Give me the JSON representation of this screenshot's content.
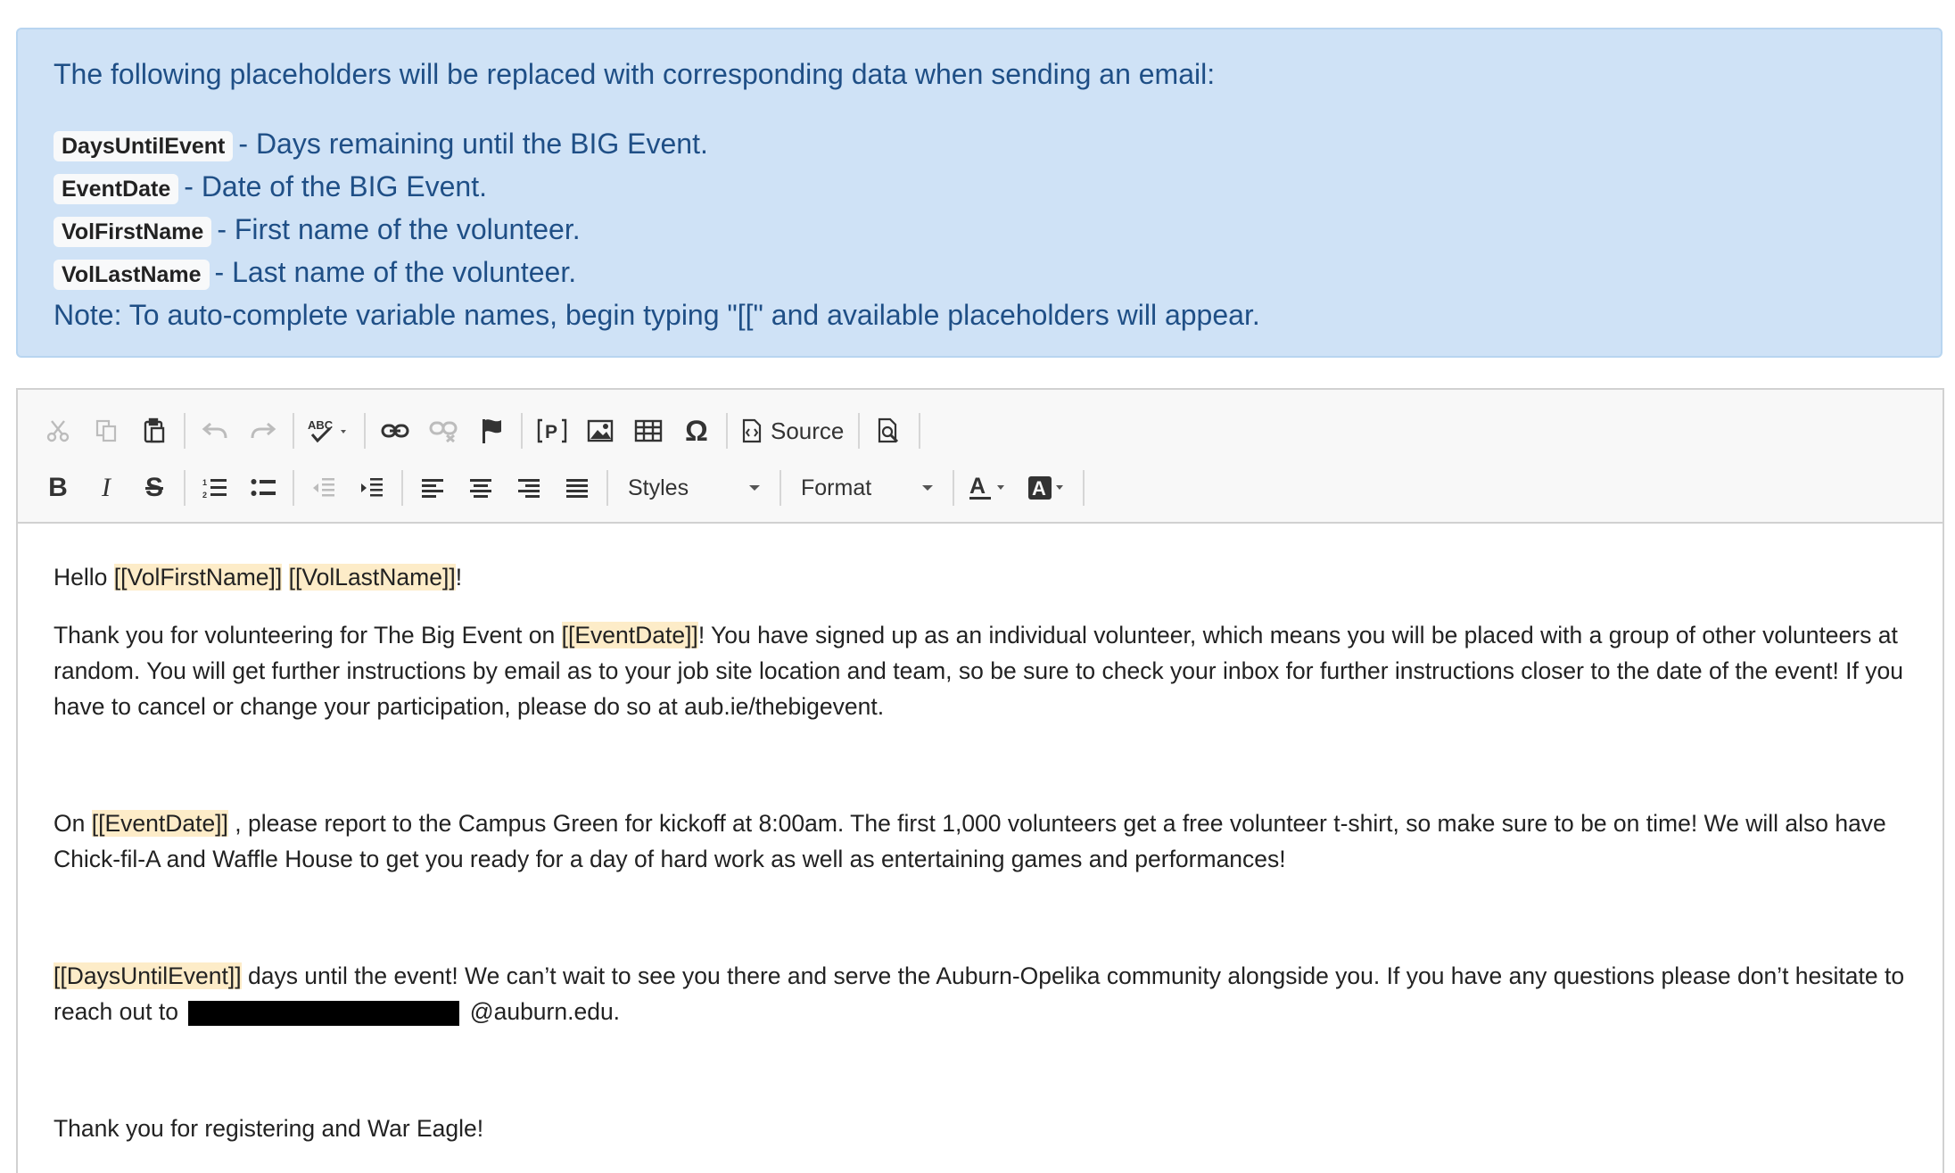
{
  "info": {
    "intro": "The following placeholders will be replaced with corresponding data when sending an email:",
    "placeholders": [
      {
        "code": "DaysUntilEvent",
        "desc": "- Days remaining until the BIG Event."
      },
      {
        "code": "EventDate",
        "desc": "- Date of the BIG Event."
      },
      {
        "code": "VolFirstName",
        "desc": "- First name of the volunteer."
      },
      {
        "code": "VolLastName",
        "desc": "- Last name of the volunteer."
      }
    ],
    "note": "Note: To auto-complete variable names, begin typing \"[[\" and available placeholders will appear."
  },
  "toolbar": {
    "source_label": "Source",
    "styles_label": "Styles",
    "format_label": "Format"
  },
  "body": {
    "greeting": {
      "pre": "Hello ",
      "ph1": "[[VolFirstName]]",
      "mid": " ",
      "ph2": "[[VolLastName]]",
      "post": "!"
    },
    "p1": {
      "pre": "Thank you for volunteering for The Big Event on ",
      "ph": "[[EventDate]]",
      "post": "! You have signed up as an individual volunteer, which means you will be placed with a group of other volunteers at random. You will get further instructions by email as to your job site location and team, so be sure to check your inbox for further instructions closer to the date of the event! If you have to cancel or change your participation, please do so at aub.ie/thebigevent."
    },
    "p2": {
      "pre": "On ",
      "ph": "[[EventDate]]",
      "post": " , please report to the Campus Green for kickoff at 8:00am. The first 1,000 volunteers get a free volunteer t-shirt, so make sure to be on time! We will also have Chick-fil-A and Waffle House to get you ready for a day of hard work as well as entertaining games and performances!"
    },
    "p3": {
      "ph": "[[DaysUntilEvent]]",
      "post": " days until the event! We can’t wait to see you there and serve the Auburn-Opelika community alongside you. If you have any questions please don’t hesitate to reach out to ",
      "suffix": " @auburn.edu."
    },
    "closing": "Thank you for registering and War Eagle!"
  }
}
